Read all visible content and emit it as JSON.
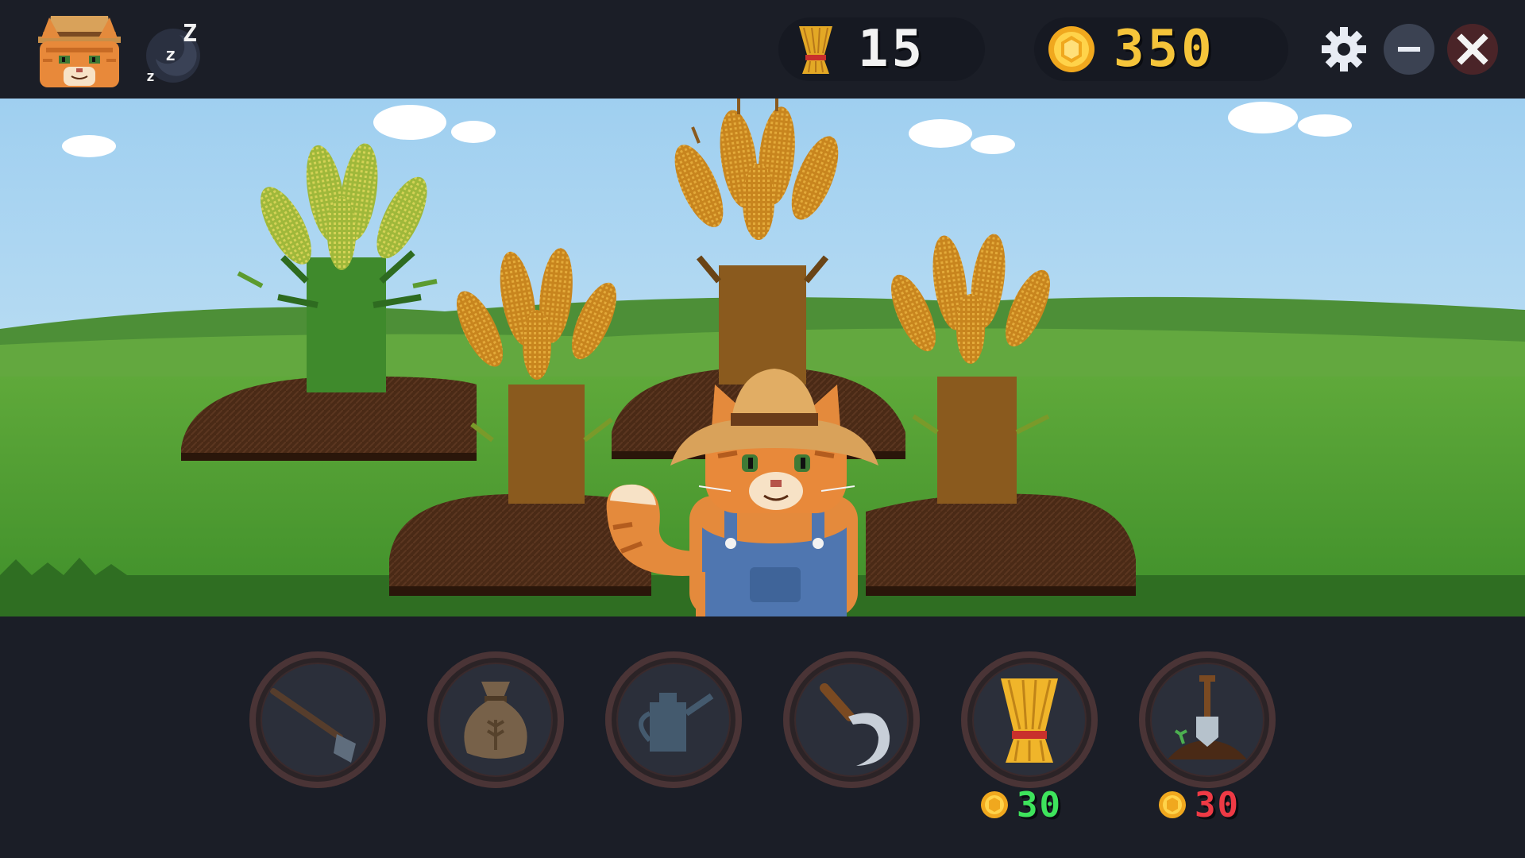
{
  "hud": {
    "wheat_count": "15",
    "coin_count": "350",
    "colors": {
      "wheat_text": "#f2f2f2",
      "coin_text": "#f5c43a",
      "affordable_price": "#3ee45c",
      "unaffordable_price": "#ee3a45"
    }
  },
  "window_controls": {
    "settings_icon": "gear-icon",
    "minimize_icon": "minimize-icon",
    "close_icon": "close-icon"
  },
  "player": {
    "avatar_icon": "cat-farmer-avatar",
    "status_icon": "sleep-zzz-icon"
  },
  "field": {
    "plots": [
      {
        "crop": "wheat",
        "stage": "growing"
      },
      {
        "crop": "wheat",
        "stage": "ripe"
      },
      {
        "crop": "wheat",
        "stage": "ripe"
      },
      {
        "crop": "wheat",
        "stage": "ripe"
      }
    ],
    "character": "cat-farmer"
  },
  "toolbar": {
    "tools": [
      {
        "icon": "hoe-icon",
        "enabled": false
      },
      {
        "icon": "seed-bag-icon",
        "enabled": false
      },
      {
        "icon": "watering-can-icon",
        "enabled": false
      },
      {
        "icon": "sickle-icon",
        "enabled": true
      },
      {
        "icon": "wheat-sheaf-icon",
        "enabled": true,
        "price": "30"
      },
      {
        "icon": "shovel-plot-icon",
        "enabled": true,
        "price": "30"
      }
    ]
  }
}
